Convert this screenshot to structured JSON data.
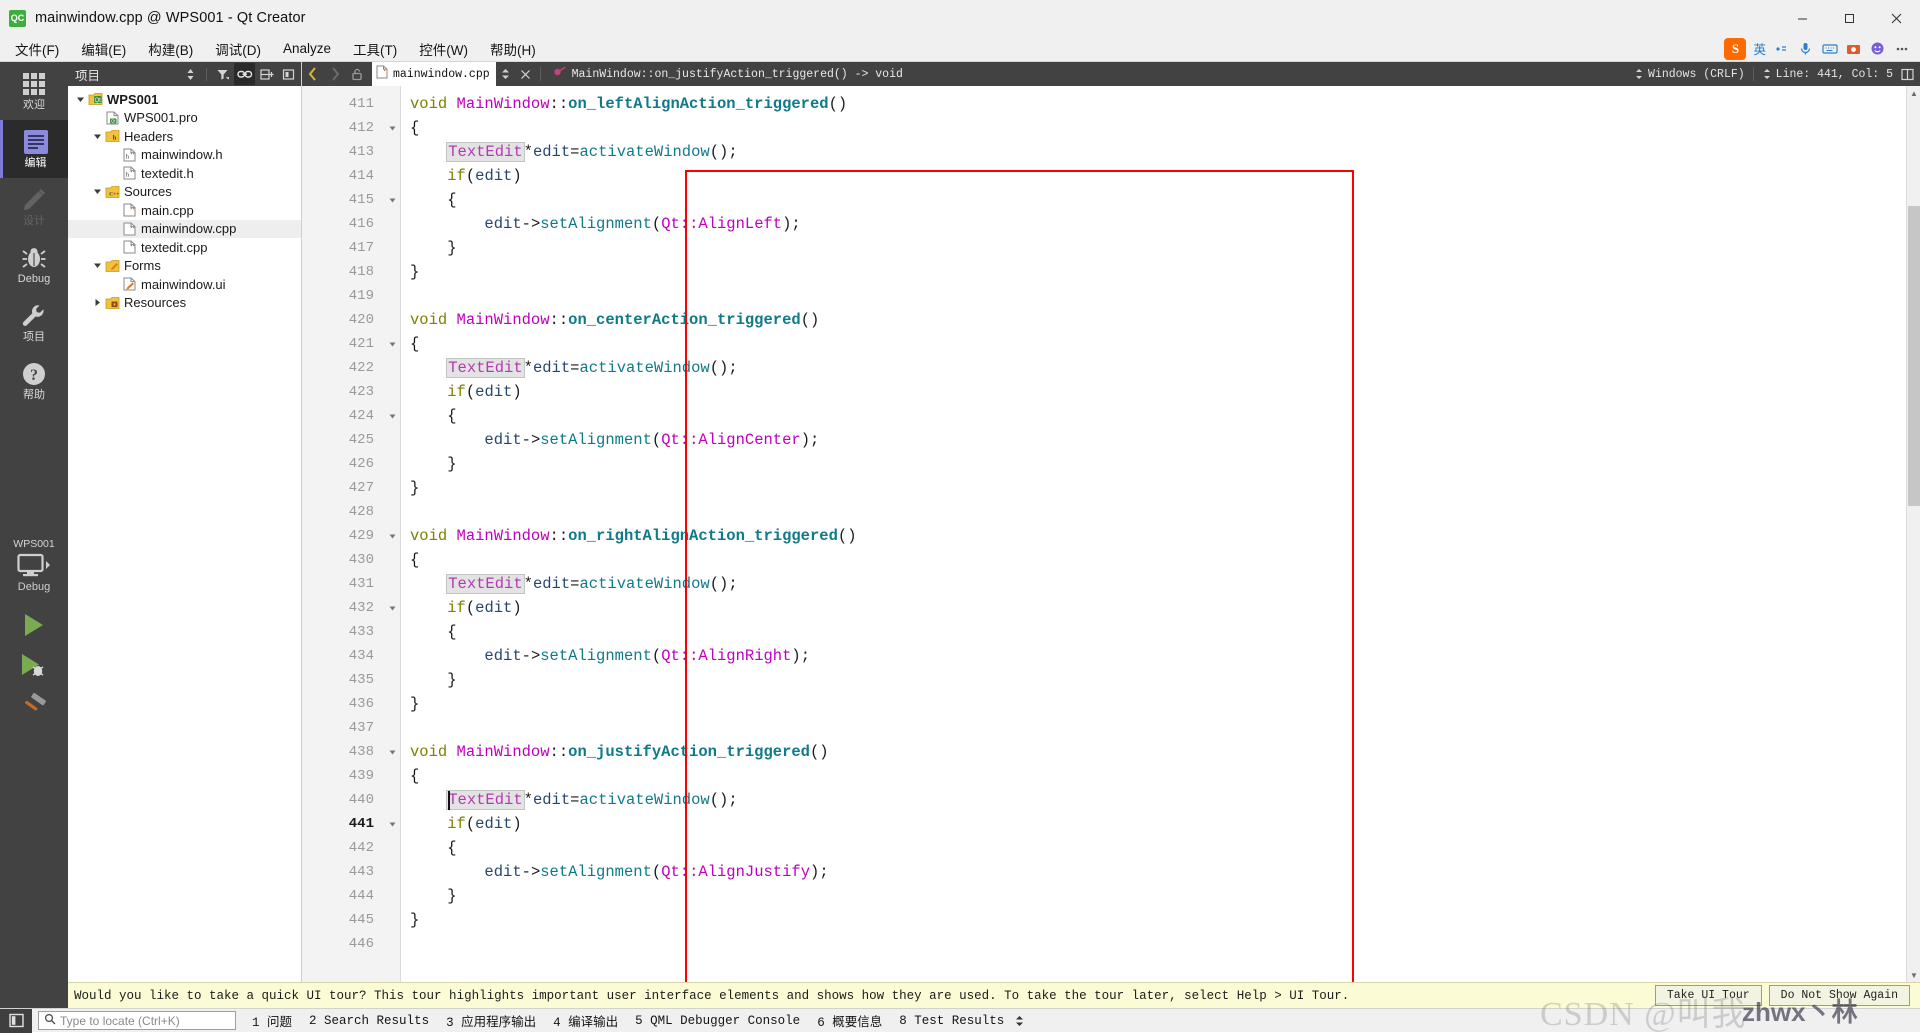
{
  "window": {
    "title": "mainwindow.cpp @ WPS001 - Qt Creator",
    "logo_text": "QC",
    "minimize": "minimize",
    "maximize": "maximize",
    "close": "close"
  },
  "menubar": {
    "items": [
      {
        "label": "文件(F)"
      },
      {
        "label": "编辑(E)"
      },
      {
        "label": "构建(B)"
      },
      {
        "label": "调试(D)"
      },
      {
        "label": "Analyze"
      },
      {
        "label": "工具(T)"
      },
      {
        "label": "控件(W)"
      },
      {
        "label": "帮助(H)"
      }
    ]
  },
  "tray": {
    "sogou_label": "S",
    "ime_label": "英",
    "icons": [
      "ime-mode-icon",
      "keyboard-icon",
      "mic-icon",
      "screenshot-icon",
      "emoji-icon",
      "skin-icon",
      "apps-icon",
      "more-icon"
    ]
  },
  "modebar": {
    "items": [
      {
        "label": "欢迎",
        "icon": "grid-icon",
        "state": "normal"
      },
      {
        "label": "编辑",
        "icon": "edit-lines-icon",
        "state": "active"
      },
      {
        "label": "设计",
        "icon": "pencil-icon",
        "state": "disabled"
      },
      {
        "label": "Debug",
        "icon": "bug-icon",
        "state": "normal"
      },
      {
        "label": "项目",
        "icon": "wrench-icon",
        "state": "normal"
      },
      {
        "label": "帮助",
        "icon": "question-icon",
        "state": "normal"
      }
    ],
    "kit": {
      "project": "WPS001",
      "build_config": "Debug",
      "icon": "desktop-icon"
    },
    "actions": [
      {
        "name": "run-button",
        "icon": "play-icon"
      },
      {
        "name": "debug-button",
        "icon": "play-bug-icon"
      },
      {
        "name": "build-button",
        "icon": "hammer-icon"
      }
    ]
  },
  "project_panel": {
    "title": "项目",
    "tools": [
      {
        "name": "sort-icon"
      },
      {
        "name": "filter-icon"
      },
      {
        "name": "link-icon",
        "active": true
      },
      {
        "name": "split-icon"
      },
      {
        "name": "collapse-icon"
      }
    ],
    "tree": [
      {
        "label": "WPS001",
        "depth": 0,
        "arrow": "down",
        "icon": "qt-project-icon",
        "bold": true,
        "selected": false
      },
      {
        "label": "WPS001.pro",
        "depth": 1,
        "arrow": "none",
        "icon": "pro-file-icon",
        "bold": false,
        "selected": false
      },
      {
        "label": "Headers",
        "depth": 1,
        "arrow": "down",
        "icon": "folder-h-icon",
        "bold": false,
        "selected": false
      },
      {
        "label": "mainwindow.h",
        "depth": 2,
        "arrow": "none",
        "icon": "header-file-icon",
        "bold": false,
        "selected": false
      },
      {
        "label": "textedit.h",
        "depth": 2,
        "arrow": "none",
        "icon": "header-file-icon",
        "bold": false,
        "selected": false
      },
      {
        "label": "Sources",
        "depth": 1,
        "arrow": "down",
        "icon": "folder-cpp-icon",
        "bold": false,
        "selected": false
      },
      {
        "label": "main.cpp",
        "depth": 2,
        "arrow": "none",
        "icon": "cpp-file-icon",
        "bold": false,
        "selected": false
      },
      {
        "label": "mainwindow.cpp",
        "depth": 2,
        "arrow": "none",
        "icon": "cpp-file-icon",
        "bold": false,
        "selected": true
      },
      {
        "label": "textedit.cpp",
        "depth": 2,
        "arrow": "none",
        "icon": "cpp-file-icon",
        "bold": false,
        "selected": false
      },
      {
        "label": "Forms",
        "depth": 1,
        "arrow": "down",
        "icon": "folder-form-icon",
        "bold": false,
        "selected": false
      },
      {
        "label": "mainwindow.ui",
        "depth": 2,
        "arrow": "none",
        "icon": "ui-file-icon",
        "bold": false,
        "selected": false
      },
      {
        "label": "Resources",
        "depth": 1,
        "arrow": "right",
        "icon": "folder-res-icon",
        "bold": false,
        "selected": false
      }
    ]
  },
  "editor_toolbar": {
    "tab_name": "mainwindow.cpp",
    "symbol": "MainWindow::on_justifyAction_triggered() -> void",
    "line_ending": "Windows (CRLF)",
    "cursor_position": "Line: 441, Col: 5"
  },
  "editor": {
    "first_line": 411,
    "current_line": 441,
    "lines": [
      {
        "n": 411,
        "fold": "",
        "tokens": [
          {
            "t": "void ",
            "c": "k-void"
          },
          {
            "t": "MainWindow",
            "c": "k-cls"
          },
          {
            "t": "::",
            "c": "k-plain"
          },
          {
            "t": "on_leftAlignAction_triggered",
            "c": "k-fn"
          },
          {
            "t": "()",
            "c": "k-plain"
          }
        ]
      },
      {
        "n": 412,
        "fold": "v",
        "tokens": [
          {
            "t": "{",
            "c": "k-plain"
          }
        ]
      },
      {
        "n": 413,
        "fold": "",
        "tokens": [
          {
            "t": "    ",
            "c": "k-plain"
          },
          {
            "t": "TextEdit",
            "c": "k-type-hl"
          },
          {
            "t": "*",
            "c": "k-plain"
          },
          {
            "t": "edit",
            "c": "k-var"
          },
          {
            "t": "=",
            "c": "k-plain"
          },
          {
            "t": "activateWindow",
            "c": "k-call"
          },
          {
            "t": "();",
            "c": "k-plain"
          }
        ]
      },
      {
        "n": 414,
        "fold": "",
        "tokens": [
          {
            "t": "    ",
            "c": "k-plain"
          },
          {
            "t": "if",
            "c": "k-void"
          },
          {
            "t": "(",
            "c": "k-plain"
          },
          {
            "t": "edit",
            "c": "k-var"
          },
          {
            "t": ")",
            "c": "k-plain"
          }
        ]
      },
      {
        "n": 415,
        "fold": "v",
        "tokens": [
          {
            "t": "    {",
            "c": "k-plain"
          }
        ]
      },
      {
        "n": 416,
        "fold": "",
        "tokens": [
          {
            "t": "        ",
            "c": "k-plain"
          },
          {
            "t": "edit",
            "c": "k-var"
          },
          {
            "t": "->",
            "c": "k-plain"
          },
          {
            "t": "setAlignment",
            "c": "k-call"
          },
          {
            "t": "(",
            "c": "k-plain"
          },
          {
            "t": "Qt::AlignLeft",
            "c": "k-enum"
          },
          {
            "t": ");",
            "c": "k-plain"
          }
        ]
      },
      {
        "n": 417,
        "fold": "",
        "tokens": [
          {
            "t": "    }",
            "c": "k-plain"
          }
        ]
      },
      {
        "n": 418,
        "fold": "",
        "tokens": [
          {
            "t": "}",
            "c": "k-plain"
          }
        ]
      },
      {
        "n": 419,
        "fold": "",
        "tokens": []
      },
      {
        "n": 420,
        "fold": "",
        "tokens": [
          {
            "t": "void ",
            "c": "k-void"
          },
          {
            "t": "MainWindow",
            "c": "k-cls"
          },
          {
            "t": "::",
            "c": "k-plain"
          },
          {
            "t": "on_centerAction_triggered",
            "c": "k-fn"
          },
          {
            "t": "()",
            "c": "k-plain"
          }
        ]
      },
      {
        "n": 421,
        "fold": "v",
        "tokens": [
          {
            "t": "{",
            "c": "k-plain"
          }
        ]
      },
      {
        "n": 422,
        "fold": "",
        "tokens": [
          {
            "t": "    ",
            "c": "k-plain"
          },
          {
            "t": "TextEdit",
            "c": "k-type-hl"
          },
          {
            "t": "*",
            "c": "k-plain"
          },
          {
            "t": "edit",
            "c": "k-var"
          },
          {
            "t": "=",
            "c": "k-plain"
          },
          {
            "t": "activateWindow",
            "c": "k-call"
          },
          {
            "t": "();",
            "c": "k-plain"
          }
        ]
      },
      {
        "n": 423,
        "fold": "",
        "tokens": [
          {
            "t": "    ",
            "c": "k-plain"
          },
          {
            "t": "if",
            "c": "k-void"
          },
          {
            "t": "(",
            "c": "k-plain"
          },
          {
            "t": "edit",
            "c": "k-var"
          },
          {
            "t": ")",
            "c": "k-plain"
          }
        ]
      },
      {
        "n": 424,
        "fold": "v",
        "tokens": [
          {
            "t": "    {",
            "c": "k-plain"
          }
        ]
      },
      {
        "n": 425,
        "fold": "",
        "tokens": [
          {
            "t": "        ",
            "c": "k-plain"
          },
          {
            "t": "edit",
            "c": "k-var"
          },
          {
            "t": "->",
            "c": "k-plain"
          },
          {
            "t": "setAlignment",
            "c": "k-call"
          },
          {
            "t": "(",
            "c": "k-plain"
          },
          {
            "t": "Qt::AlignCenter",
            "c": "k-enum"
          },
          {
            "t": ");",
            "c": "k-plain"
          }
        ]
      },
      {
        "n": 426,
        "fold": "",
        "tokens": [
          {
            "t": "    }",
            "c": "k-plain"
          }
        ]
      },
      {
        "n": 427,
        "fold": "",
        "tokens": [
          {
            "t": "}",
            "c": "k-plain"
          }
        ]
      },
      {
        "n": 428,
        "fold": "",
        "tokens": []
      },
      {
        "n": 429,
        "fold": "v",
        "tokens": [
          {
            "t": "void ",
            "c": "k-void"
          },
          {
            "t": "MainWindow",
            "c": "k-cls"
          },
          {
            "t": "::",
            "c": "k-plain"
          },
          {
            "t": "on_rightAlignAction_triggered",
            "c": "k-fn"
          },
          {
            "t": "()",
            "c": "k-plain"
          }
        ]
      },
      {
        "n": 430,
        "fold": "",
        "tokens": [
          {
            "t": "{",
            "c": "k-plain"
          }
        ]
      },
      {
        "n": 431,
        "fold": "",
        "tokens": [
          {
            "t": "    ",
            "c": "k-plain"
          },
          {
            "t": "TextEdit",
            "c": "k-type-hl"
          },
          {
            "t": "*",
            "c": "k-plain"
          },
          {
            "t": "edit",
            "c": "k-var"
          },
          {
            "t": "=",
            "c": "k-plain"
          },
          {
            "t": "activateWindow",
            "c": "k-call"
          },
          {
            "t": "();",
            "c": "k-plain"
          }
        ]
      },
      {
        "n": 432,
        "fold": "v",
        "tokens": [
          {
            "t": "    ",
            "c": "k-plain"
          },
          {
            "t": "if",
            "c": "k-void"
          },
          {
            "t": "(",
            "c": "k-plain"
          },
          {
            "t": "edit",
            "c": "k-var"
          },
          {
            "t": ")",
            "c": "k-plain"
          }
        ]
      },
      {
        "n": 433,
        "fold": "",
        "tokens": [
          {
            "t": "    {",
            "c": "k-plain"
          }
        ]
      },
      {
        "n": 434,
        "fold": "",
        "tokens": [
          {
            "t": "        ",
            "c": "k-plain"
          },
          {
            "t": "edit",
            "c": "k-var"
          },
          {
            "t": "->",
            "c": "k-plain"
          },
          {
            "t": "setAlignment",
            "c": "k-call"
          },
          {
            "t": "(",
            "c": "k-plain"
          },
          {
            "t": "Qt::AlignRight",
            "c": "k-enum"
          },
          {
            "t": ");",
            "c": "k-plain"
          }
        ]
      },
      {
        "n": 435,
        "fold": "",
        "tokens": [
          {
            "t": "    }",
            "c": "k-plain"
          }
        ]
      },
      {
        "n": 436,
        "fold": "",
        "tokens": [
          {
            "t": "}",
            "c": "k-plain"
          }
        ]
      },
      {
        "n": 437,
        "fold": "",
        "tokens": []
      },
      {
        "n": 438,
        "fold": "v",
        "tokens": [
          {
            "t": "void ",
            "c": "k-void"
          },
          {
            "t": "MainWindow",
            "c": "k-cls"
          },
          {
            "t": "::",
            "c": "k-plain"
          },
          {
            "t": "on_justifyAction_triggered",
            "c": "k-fn"
          },
          {
            "t": "()",
            "c": "k-plain"
          }
        ]
      },
      {
        "n": 439,
        "fold": "",
        "tokens": [
          {
            "t": "{",
            "c": "k-plain"
          }
        ]
      },
      {
        "n": 440,
        "fold": "",
        "tokens": [
          {
            "t": "    ",
            "c": "k-plain"
          },
          {
            "t": "TextEdit",
            "c": "k-type-hl"
          },
          {
            "t": "*",
            "c": "k-plain"
          },
          {
            "t": "edit",
            "c": "k-var"
          },
          {
            "t": "=",
            "c": "k-plain"
          },
          {
            "t": "activateWindow",
            "c": "k-call"
          },
          {
            "t": "();",
            "c": "k-plain"
          }
        ]
      },
      {
        "n": 441,
        "fold": "v",
        "tokens": [
          {
            "t": "    ",
            "c": "k-plain"
          },
          {
            "t": "if",
            "c": "k-void"
          },
          {
            "t": "(",
            "c": "k-plain"
          },
          {
            "t": "edit",
            "c": "k-var"
          },
          {
            "t": ")",
            "c": "k-plain"
          }
        ]
      },
      {
        "n": 442,
        "fold": "",
        "tokens": [
          {
            "t": "    {",
            "c": "k-plain"
          }
        ]
      },
      {
        "n": 443,
        "fold": "",
        "tokens": [
          {
            "t": "        ",
            "c": "k-plain"
          },
          {
            "t": "edit",
            "c": "k-var"
          },
          {
            "t": "->",
            "c": "k-plain"
          },
          {
            "t": "setAlignment",
            "c": "k-call"
          },
          {
            "t": "(",
            "c": "k-plain"
          },
          {
            "t": "Qt::AlignJustify",
            "c": "k-enum"
          },
          {
            "t": ");",
            "c": "k-plain"
          }
        ]
      },
      {
        "n": 444,
        "fold": "",
        "tokens": [
          {
            "t": "    }",
            "c": "k-plain"
          }
        ]
      },
      {
        "n": 445,
        "fold": "",
        "tokens": [
          {
            "t": "}",
            "c": "k-plain"
          }
        ]
      },
      {
        "n": 446,
        "fold": "",
        "tokens": []
      }
    ]
  },
  "tour": {
    "message": "Would you like to take a quick UI tour? This tour highlights important user interface elements and shows how they are used. To take the tour later, select Help > UI Tour.",
    "take_label": "Take UI Tour",
    "dismiss_label": "Do Not Show Again"
  },
  "bottombar": {
    "sidebar_toggle": "sidebar-toggle-icon",
    "locator_placeholder": "Type to locate (Ctrl+K)",
    "outputs": [
      {
        "num": "1",
        "label": "问题"
      },
      {
        "num": "2",
        "label": "Search Results"
      },
      {
        "num": "3",
        "label": "应用程序输出"
      },
      {
        "num": "4",
        "label": "编译输出"
      },
      {
        "num": "5",
        "label": "QML Debugger Console"
      },
      {
        "num": "6",
        "label": "概要信息"
      },
      {
        "num": "8",
        "label": "Test Results"
      }
    ]
  },
  "watermark": {
    "text": "CSDN @叫我",
    "text2": "zhwx丶林"
  },
  "colors": {
    "accent": "#7c7cd8",
    "chrome_dark": "#424242",
    "highlight_box": "#ff0000",
    "tour_bg": "#fbfbd6"
  }
}
